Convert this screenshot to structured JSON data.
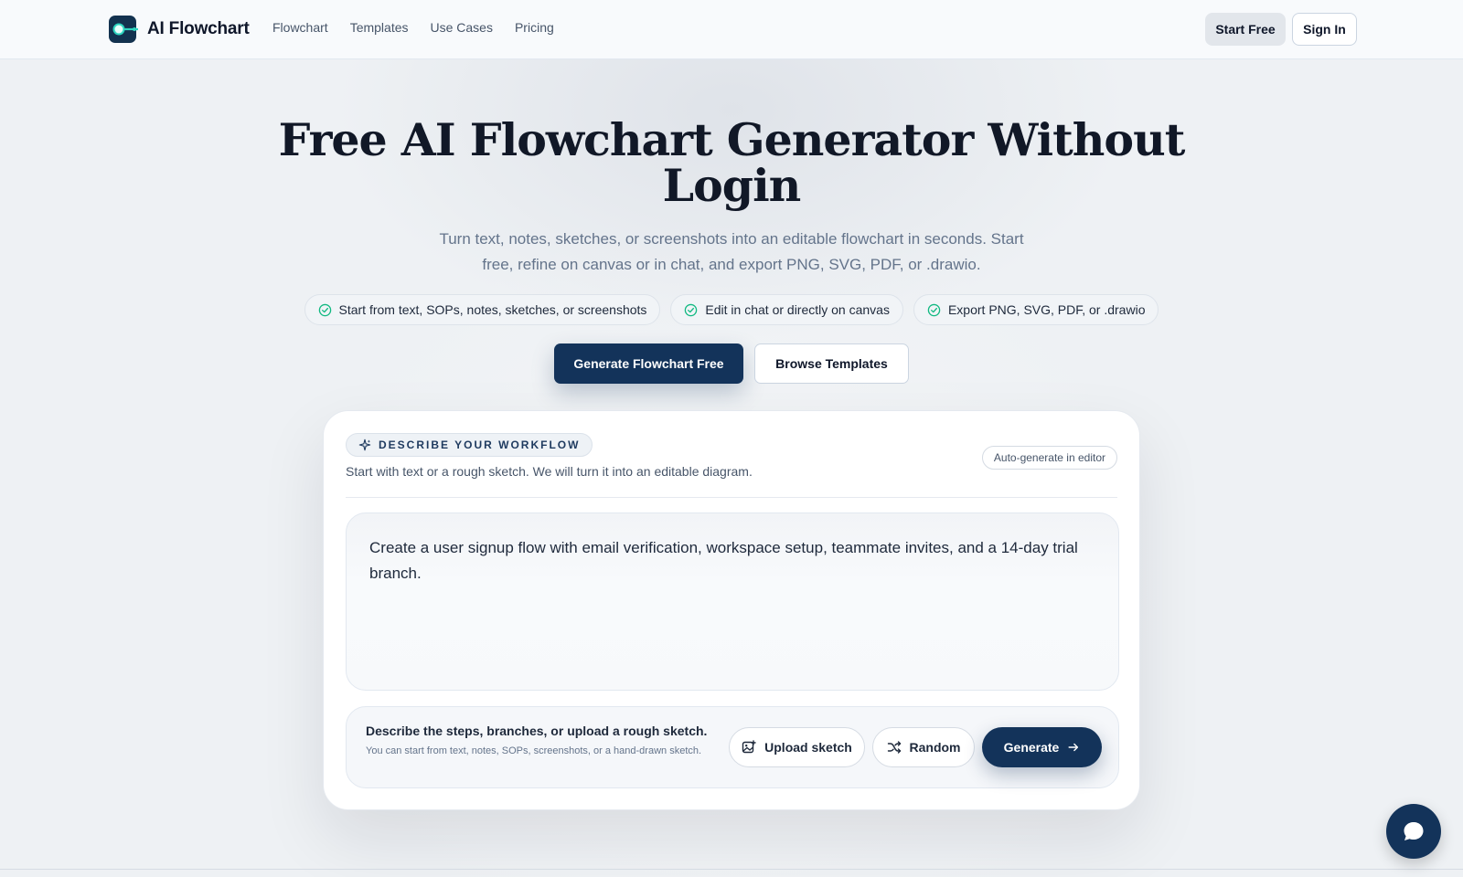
{
  "app": {
    "name": "AI Flowchart"
  },
  "nav": {
    "items": [
      "Flowchart",
      "Templates",
      "Use Cases",
      "Pricing"
    ]
  },
  "header": {
    "start_free": "Start Free",
    "sign_in": "Sign In"
  },
  "hero": {
    "title": "Free AI Flowchart Generator Without Login",
    "subtitle": "Turn text, notes, sketches, or screenshots into an editable flowchart in seconds. Start free, refine on canvas or in chat, and export PNG, SVG, PDF, or .drawio.",
    "features": [
      "Start from text, SOPs, notes, sketches, or screenshots",
      "Edit in chat or directly on canvas",
      "Export PNG, SVG, PDF, or .drawio"
    ],
    "primary_cta": "Generate Flowchart Free",
    "secondary_cta": "Browse Templates"
  },
  "card": {
    "badge": "DESCRIBE YOUR WORKFLOW",
    "description": "Start with text or a rough sketch. We will turn it into an editable diagram.",
    "auto_pill": "Auto-generate in editor",
    "prompt_value": "Create a user signup flow with email verification, workspace setup, teammate invites, and a 14-day trial branch.",
    "hint_title": "Describe the steps, branches, or upload a rough sketch.",
    "hint_sub": "You can start from text, notes, SOPs, screenshots, or a hand-drawn sketch.",
    "upload_label": "Upload sketch",
    "random_label": "Random",
    "generate_label": "Generate"
  },
  "colors": {
    "brand": "#13335a",
    "accent_check": "#10b981",
    "logo_accent": "#2dd4bf"
  }
}
